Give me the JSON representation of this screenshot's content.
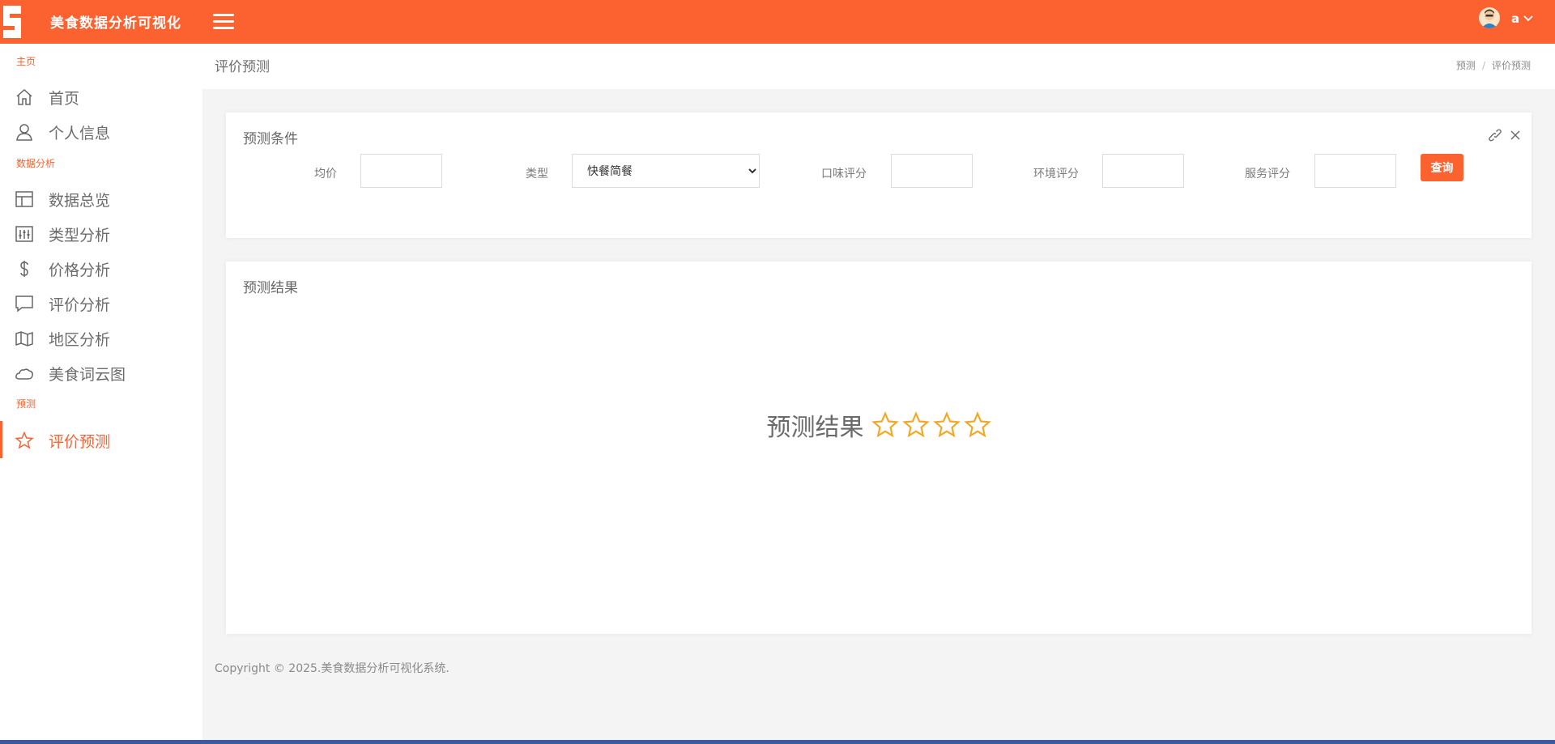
{
  "app": {
    "title": "美食数据分析可视化",
    "user": "a"
  },
  "sidebar": {
    "sections": [
      {
        "label": "主页"
      },
      {
        "label": "数据分析"
      },
      {
        "label": "预测"
      }
    ],
    "items": [
      {
        "label": "首页",
        "icon": "home-icon"
      },
      {
        "label": "个人信息",
        "icon": "user-icon"
      },
      {
        "label": "数据总览",
        "icon": "layout-icon"
      },
      {
        "label": "类型分析",
        "icon": "sliders-icon"
      },
      {
        "label": "价格分析",
        "icon": "dollar-icon"
      },
      {
        "label": "评价分析",
        "icon": "message-icon"
      },
      {
        "label": "地区分析",
        "icon": "map-icon"
      },
      {
        "label": "美食词云图",
        "icon": "cloud-icon"
      },
      {
        "label": "评价预测",
        "icon": "star-icon",
        "active": true
      }
    ]
  },
  "header": {
    "title": "评价预测",
    "breadcrumb": [
      "预测",
      "评价预测"
    ]
  },
  "conditions": {
    "title": "预测条件",
    "fields": [
      {
        "label": "均价",
        "value": ""
      },
      {
        "label": "类型",
        "value": "快餐简餐"
      },
      {
        "label": "口味评分",
        "value": ""
      },
      {
        "label": "环境评分",
        "value": ""
      },
      {
        "label": "服务评分",
        "value": ""
      }
    ],
    "query_label": "查询"
  },
  "result": {
    "title": "预测结果",
    "text": "预测结果",
    "stars": 4,
    "star_color": "#f5a623"
  },
  "footer": {
    "prefix": "Copyright © 2025.",
    "name": "美食数据分析可视化系统."
  },
  "colors": {
    "accent": "#fc6130"
  }
}
